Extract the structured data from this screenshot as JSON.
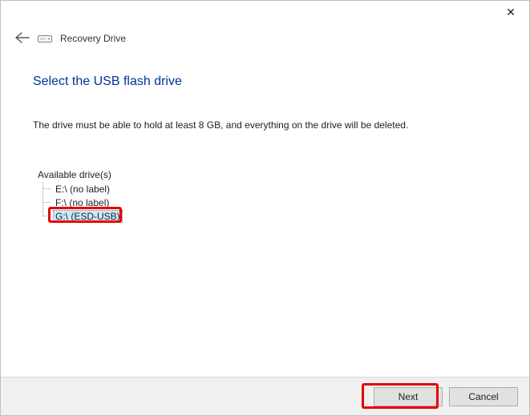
{
  "window": {
    "app_title": "Recovery Drive",
    "close_glyph": "✕"
  },
  "page": {
    "title": "Select the USB flash drive",
    "description": "The drive must be able to hold at least 8 GB, and everything on the drive will be deleted."
  },
  "drives": {
    "header": "Available drive(s)",
    "items": [
      {
        "label": "E:\\ (no label)",
        "selected": false
      },
      {
        "label": "F:\\ (no label)",
        "selected": false
      },
      {
        "label": "G:\\ (ESD-USB)",
        "selected": true
      }
    ]
  },
  "buttons": {
    "next": "Next",
    "cancel": "Cancel"
  },
  "colors": {
    "accent_title": "#003399",
    "highlight": "#e60000"
  }
}
